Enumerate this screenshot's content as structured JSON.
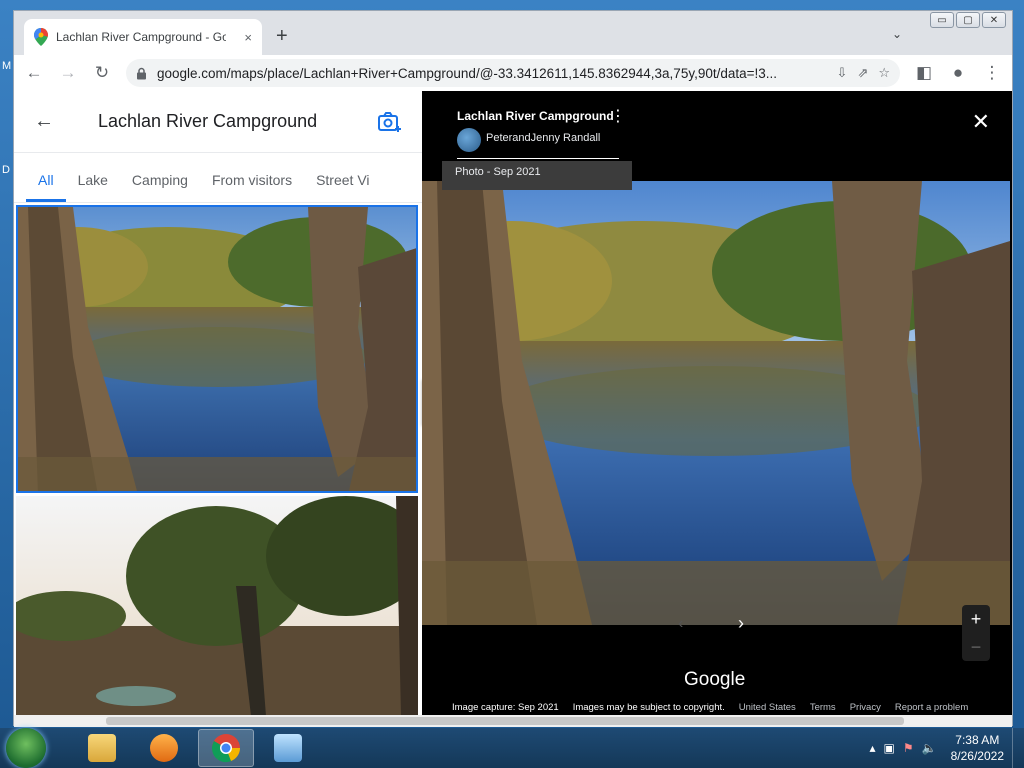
{
  "desktop": {
    "edge_text_1": "M",
    "edge_text_2": "D"
  },
  "browser": {
    "tab_title": "Lachlan River Campground - Goo",
    "tab_close": "×",
    "new_tab": "+",
    "tab_menu": "⌄",
    "url": "google.com/maps/place/Lachlan+River+Campground/@-33.3412611,145.8362944,3a,75y,90t/data=!3...",
    "window_controls": [
      "▭",
      "▢",
      "✕"
    ]
  },
  "left_panel": {
    "title": "Lachlan River Campground",
    "tabs": [
      "All",
      "Lake",
      "Camping",
      "From visitors",
      "Street Vi"
    ]
  },
  "viewer": {
    "title": "Lachlan River Campground",
    "author": "PeterandJenny Randall",
    "date": "Photo - Sep 2021",
    "brand": "Google",
    "footer": {
      "capture": "Image capture: Sep 2021",
      "copyright": "Images may be subject to copyright.",
      "country": "United States",
      "terms": "Terms",
      "privacy": "Privacy",
      "report": "Report a problem"
    }
  },
  "taskbar": {
    "time": "7:38 AM",
    "date": "8/26/2022"
  }
}
